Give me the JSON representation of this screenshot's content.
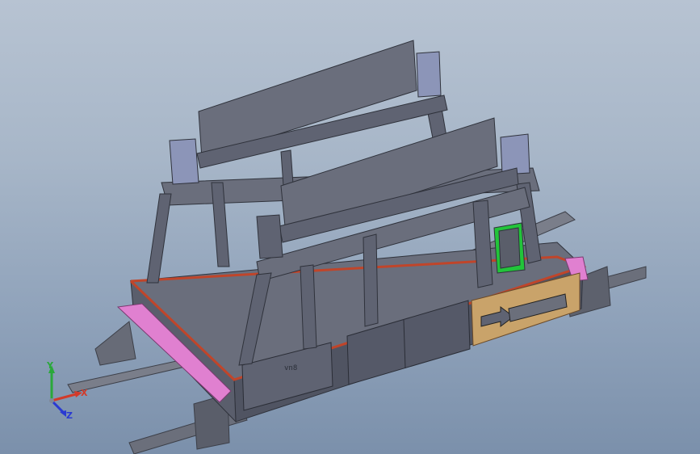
{
  "viewport": {
    "background_top": "#b7c3d2",
    "background_bottom": "#7b90ab"
  },
  "model": {
    "frame_color": "#5f6372",
    "frame_dark": "#464957",
    "frame_light": "#7b7f8d",
    "rail_color": "#6b6f7b",
    "highlight_edge": "#c0452a",
    "pink_bumper": "#e080d0",
    "wood_panel": "#c9a36a",
    "green_box": "#22c43a",
    "plate_label": "vn8"
  },
  "triad": {
    "x_label": "X",
    "y_label": "Y",
    "z_label": "Z",
    "x_color": "#d23a2a",
    "y_color": "#2aa83a",
    "z_color": "#2a3ad2"
  }
}
